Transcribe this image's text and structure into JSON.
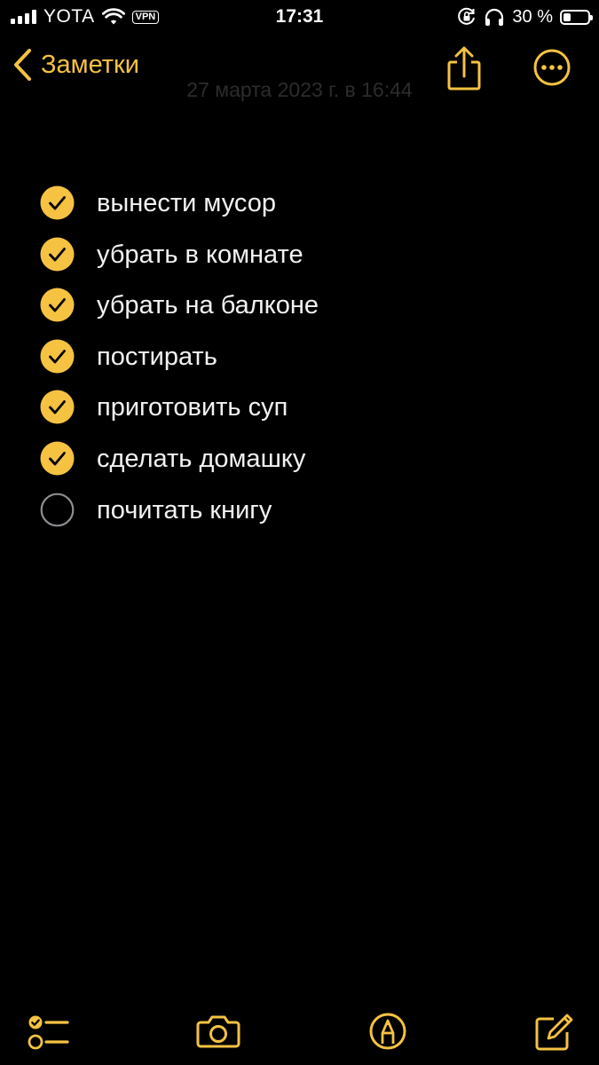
{
  "status_bar": {
    "carrier": "YOTA",
    "vpn": "VPN",
    "time": "17:31",
    "battery_text": "30 %",
    "battery_level": 0.3
  },
  "nav": {
    "back_label": "Заметки",
    "date": "27 марта 2023 г. в 16:44",
    "share_icon": "share-icon",
    "more_icon": "ellipsis-circle-icon"
  },
  "checklist": {
    "items": [
      {
        "text": "вынести мусор",
        "checked": true
      },
      {
        "text": "убрать в комнате",
        "checked": true
      },
      {
        "text": "убрать на балконе",
        "checked": true
      },
      {
        "text": "постирать",
        "checked": true
      },
      {
        "text": "приготовить суп",
        "checked": true
      },
      {
        "text": "сделать домашку",
        "checked": true
      },
      {
        "text": "почитать книгу",
        "checked": false
      }
    ]
  },
  "toolbar": {
    "icons": [
      "checklist-icon",
      "camera-icon",
      "markup-icon",
      "compose-icon"
    ]
  },
  "colors": {
    "accent": "#f5c242",
    "background": "#000000",
    "text": "#f2f2f2",
    "unchecked_ring": "#8e8e93"
  }
}
